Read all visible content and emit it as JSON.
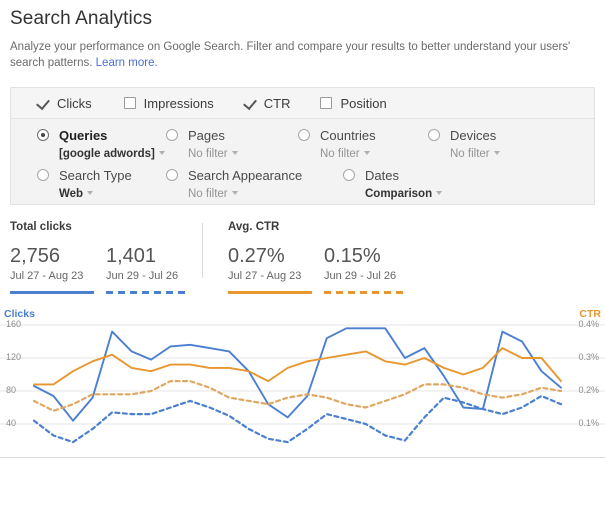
{
  "header": {
    "title": "Search Analytics",
    "description_part1": "Analyze your performance on Google Search. Filter and compare your results to better understand your users' search patterns. ",
    "learn_more": "Learn more."
  },
  "metrics": [
    {
      "label": "Clicks",
      "checked": true,
      "icon": "checkbox-checked-icon"
    },
    {
      "label": "Impressions",
      "checked": false,
      "icon": "checkbox-unchecked-icon"
    },
    {
      "label": "CTR",
      "checked": true,
      "icon": "checkbox-checked-icon"
    },
    {
      "label": "Position",
      "checked": false,
      "icon": "checkbox-unchecked-icon"
    }
  ],
  "dimensions_row1": [
    {
      "label": "Queries",
      "filter": "[google adwords]",
      "selected": true
    },
    {
      "label": "Pages",
      "filter": "No filter",
      "selected": false
    },
    {
      "label": "Countries",
      "filter": "No filter",
      "selected": false
    },
    {
      "label": "Devices",
      "filter": "No filter",
      "selected": false
    }
  ],
  "dimensions_row2": [
    {
      "label": "Search Type",
      "filter": "Web",
      "selected": false
    },
    {
      "label": "Search Appearance",
      "filter": "No filter",
      "selected": false
    },
    {
      "label": "Dates",
      "filter": "Comparison",
      "selected": false
    }
  ],
  "kpis": [
    {
      "title": "Total clicks",
      "columns": [
        {
          "value": "2,756",
          "range": "Jul 27 - Aug 23",
          "rule": "solid-blue"
        },
        {
          "value": "1,401",
          "range": "Jun 29 - Jul 26",
          "rule": "dash-blue"
        }
      ]
    },
    {
      "title": "Avg. CTR",
      "columns": [
        {
          "value": "0.27%",
          "range": "Jul 27 - Aug 23",
          "rule": "solid-orange"
        },
        {
          "value": "0.15%",
          "range": "Jun 29 - Jul 26",
          "rule": "dash-orange"
        }
      ]
    }
  ],
  "chart_data": {
    "type": "line",
    "title": "",
    "left_axis_name": "Clicks",
    "right_axis_name": "CTR",
    "grid": true,
    "legend": "none",
    "left_ticks": [
      "160",
      "120",
      "80",
      "40"
    ],
    "right_ticks": [
      "0.4%",
      "0.3%",
      "0.2%",
      "0.1%"
    ],
    "left_ylim": [
      0,
      180
    ],
    "right_ylim": [
      0,
      0.45
    ],
    "x": [
      1,
      2,
      3,
      4,
      5,
      6,
      7,
      8,
      9,
      10,
      11,
      12,
      13,
      14,
      15,
      16,
      17,
      18,
      19,
      20,
      21,
      22,
      23,
      24,
      25,
      26,
      27,
      28
    ],
    "colors": {
      "clicks_current": "#4b7fd0",
      "clicks_previous": "#4b7fd0",
      "ctr_current": "#e8962e",
      "ctr_previous": "#e0a763"
    },
    "series": [
      {
        "name": "Clicks Jul 27 - Aug 23",
        "axis": "left",
        "style": "solid",
        "color": "#4b7fd0",
        "values": [
          86,
          74,
          44,
          72,
          152,
          128,
          118,
          134,
          136,
          132,
          128,
          104,
          64,
          48,
          74,
          144,
          156,
          156,
          156,
          120,
          132,
          98,
          60,
          58,
          152,
          140,
          104,
          84
        ]
      },
      {
        "name": "Clicks Jun 29 - Jul 26",
        "axis": "left",
        "style": "dashed",
        "color": "#4b7fd0",
        "values": [
          44,
          26,
          18,
          34,
          54,
          52,
          52,
          60,
          68,
          60,
          50,
          34,
          22,
          18,
          34,
          52,
          46,
          40,
          26,
          20,
          48,
          72,
          66,
          58,
          52,
          60,
          74,
          64
        ]
      },
      {
        "name": "CTR Jul 27 - Aug 23",
        "axis": "right",
        "style": "solid",
        "color": "#e8962e",
        "values": [
          0.22,
          0.22,
          0.26,
          0.29,
          0.31,
          0.27,
          0.26,
          0.28,
          0.28,
          0.27,
          0.27,
          0.26,
          0.23,
          0.27,
          0.29,
          0.3,
          0.31,
          0.32,
          0.29,
          0.28,
          0.3,
          0.27,
          0.25,
          0.27,
          0.33,
          0.3,
          0.3,
          0.23
        ]
      },
      {
        "name": "CTR Jun 29 - Jul 26",
        "axis": "right",
        "style": "dashed",
        "color": "#e0a763",
        "values": [
          0.17,
          0.14,
          0.16,
          0.19,
          0.19,
          0.19,
          0.2,
          0.23,
          0.23,
          0.21,
          0.18,
          0.17,
          0.16,
          0.18,
          0.19,
          0.18,
          0.16,
          0.15,
          0.17,
          0.19,
          0.22,
          0.22,
          0.21,
          0.19,
          0.18,
          0.19,
          0.21,
          0.2
        ]
      }
    ]
  }
}
